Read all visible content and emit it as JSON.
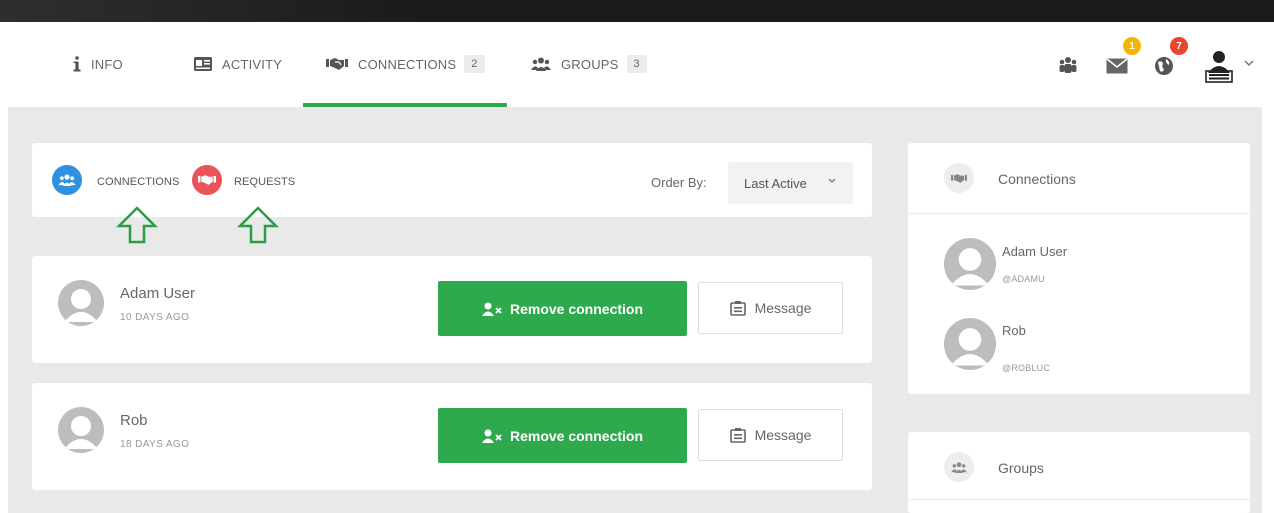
{
  "nav": {
    "tabs": [
      {
        "label": "INFO",
        "icon": "info-icon"
      },
      {
        "label": "ACTIVITY",
        "icon": "id-card-icon"
      },
      {
        "label": "CONNECTIONS",
        "icon": "handshake-icon",
        "count": "2"
      },
      {
        "label": "GROUPS",
        "icon": "users-icon",
        "count": "3"
      }
    ],
    "active_tab": "CONNECTIONS",
    "icons": {
      "mail_badge": "1",
      "notifications_badge": "7"
    }
  },
  "filter": {
    "connections_label": "CONNECTIONS",
    "requests_label": "REQUESTS",
    "order_by_label": "Order By:",
    "order_by_value": "Last Active"
  },
  "connections": [
    {
      "name": "Adam User",
      "time": "10 DAYS AGO",
      "remove_label": "Remove connection",
      "message_label": "Message"
    },
    {
      "name": "Rob",
      "time": "18 DAYS AGO",
      "remove_label": "Remove connection",
      "message_label": "Message"
    }
  ],
  "sidebar": {
    "connections_title": "Connections",
    "connections": [
      {
        "name": "Adam User",
        "handle": "@ADAMU"
      },
      {
        "name": "Rob",
        "handle": "@ROBLUC"
      }
    ],
    "groups_title": "Groups"
  },
  "colors": {
    "accent_green": "#2fa94d",
    "connections_blue": "#2f8fe0",
    "requests_red": "#e9535b",
    "badge_yellow": "#f5b400",
    "badge_red": "#e8472e",
    "arrow_green": "#2a9d46"
  }
}
